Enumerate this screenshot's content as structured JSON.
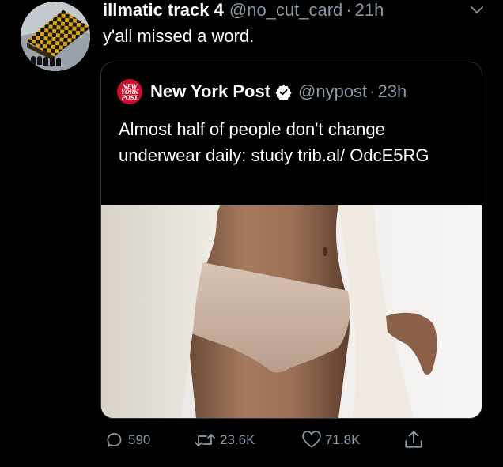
{
  "tweet": {
    "display_name": "illmatic track 4",
    "handle": "@no_cut_card",
    "separator": "·",
    "time": "21h",
    "text": "y'all missed a word."
  },
  "quoted_tweet": {
    "logo_lines": [
      "NEW",
      "YORK",
      "POST"
    ],
    "display_name": "New York Post",
    "verified": true,
    "handle": "@nypost",
    "separator": "·",
    "time": "23h",
    "text": "Almost half of people don't change underwear daily: study trib.al/ OdcE5RG",
    "image_icon": "photo-of-person-in-underwear"
  },
  "actions": {
    "reply_count": "590",
    "retweet_count": "23.6K",
    "like_count": "71.8K"
  },
  "icons": {
    "reply": "reply-icon",
    "retweet": "retweet-icon",
    "like": "heart-icon",
    "share": "share-icon",
    "menu": "chevron-down-icon",
    "verified": "verified-badge-icon"
  },
  "colors": {
    "background": "#000000",
    "text": "#ffffff",
    "secondary_text": "#8b98a5",
    "border": "#2f3336",
    "nypost_red": "#c8102e"
  }
}
